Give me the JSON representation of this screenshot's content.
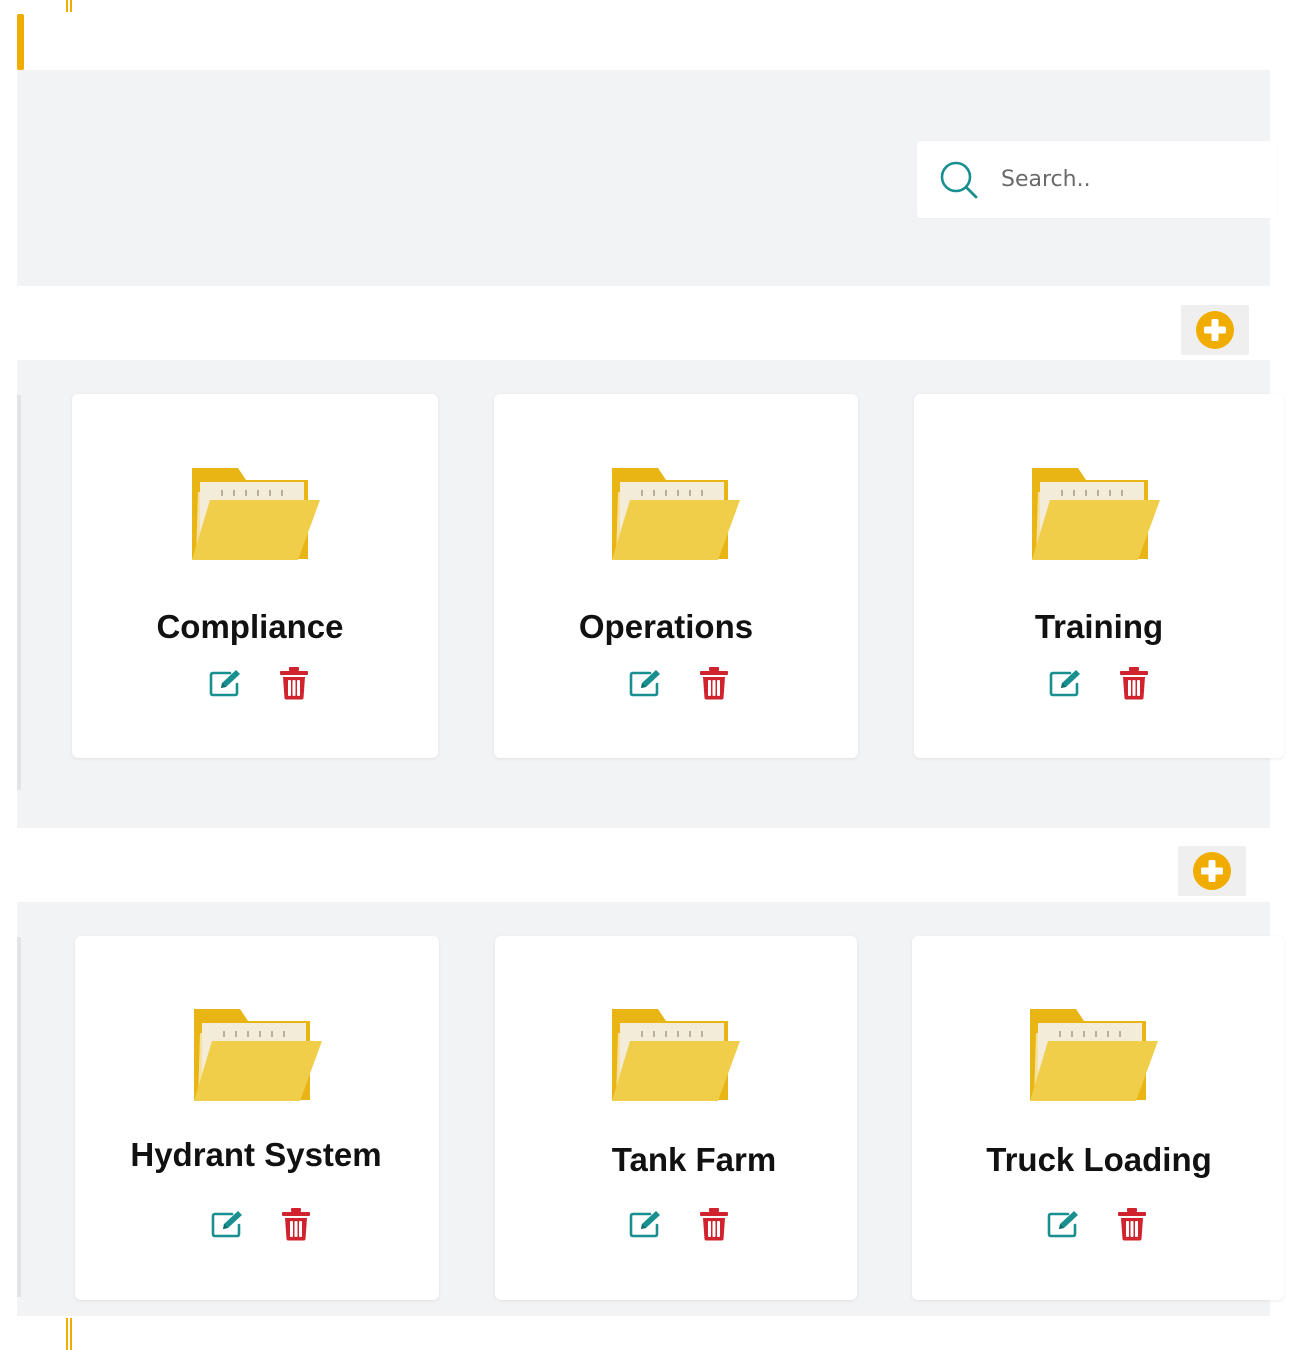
{
  "search": {
    "placeholder": "Search.."
  },
  "colors": {
    "accent": "#f0ad00",
    "edit": "#1a8f8f",
    "delete": "#d0232e",
    "folder": "#f0ce4a",
    "folder_back": "#e8b515",
    "band": "#f2f3f5"
  },
  "sections": [
    {
      "add_icon": "plus-circle-icon",
      "folders": [
        {
          "name": "Compliance"
        },
        {
          "name": "Operations"
        },
        {
          "name": "Training"
        }
      ]
    },
    {
      "add_icon": "plus-circle-icon",
      "folders": [
        {
          "name": "Hydrant System"
        },
        {
          "name": "Tank Farm"
        },
        {
          "name": "Truck Loading"
        }
      ]
    }
  ],
  "card_icons": {
    "folder": "folder-icon",
    "edit": "edit-icon",
    "delete": "trash-icon"
  }
}
